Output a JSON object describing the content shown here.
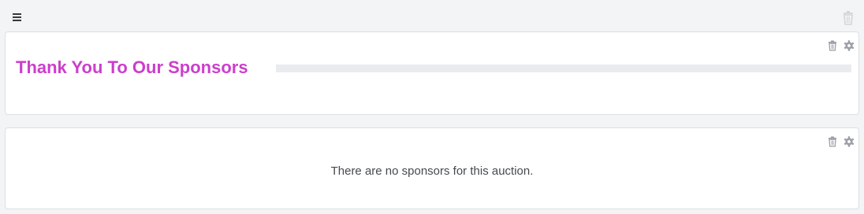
{
  "toolbar": {
    "menu_icon": "hamburger-menu-icon",
    "trash_icon": "trash-icon"
  },
  "heading_block": {
    "title": "Thank You To Our Sponsors",
    "title_color": "#cc3ecc",
    "actions": [
      "trash-icon",
      "gear-icon"
    ]
  },
  "sponsors_block": {
    "empty_message": "There are no sponsors for this auction.",
    "actions": [
      "trash-icon",
      "gear-icon"
    ]
  }
}
